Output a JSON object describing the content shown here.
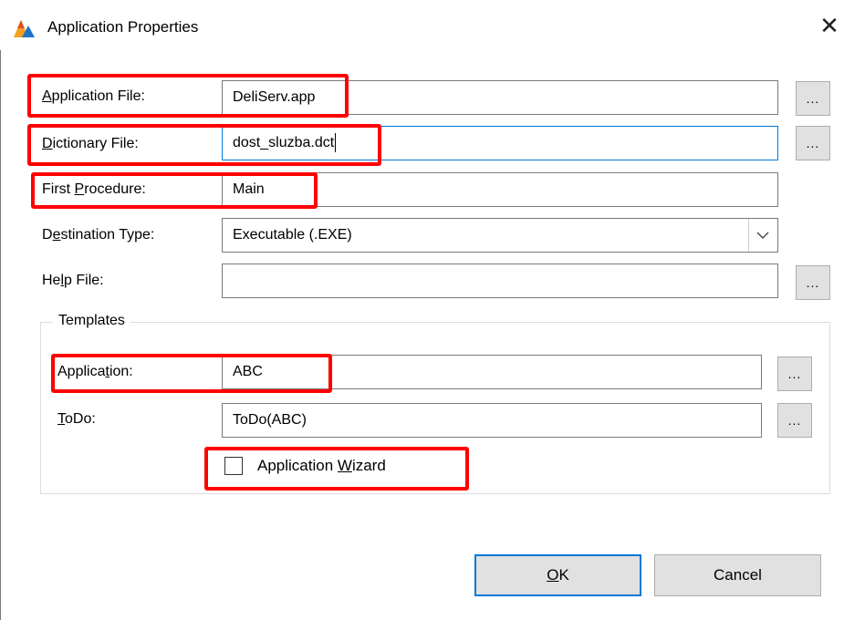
{
  "window": {
    "title": "Application Properties",
    "close_glyph": "✕",
    "app_icon": "clarion-app-icon"
  },
  "fields": {
    "application_file": {
      "label_pre": "",
      "label_key": "A",
      "label_post": "pplication File:",
      "value": "DeliServ.app"
    },
    "dictionary_file": {
      "label_pre": "",
      "label_key": "D",
      "label_post": "ictionary File:",
      "value": "dost_sluzba.dct"
    },
    "first_procedure": {
      "label_pre": "First ",
      "label_key": "P",
      "label_post": "rocedure:",
      "value": "Main"
    },
    "destination_type": {
      "label_pre": "D",
      "label_key": "e",
      "label_post": "stination Type:",
      "value": "Executable (.EXE)"
    },
    "help_file": {
      "label_pre": "He",
      "label_key": "l",
      "label_post": "p File:",
      "value": ""
    }
  },
  "browse_label": "...",
  "templates": {
    "group_title": "Templates",
    "application": {
      "label_pre": "Applica",
      "label_key": "t",
      "label_post": "ion:",
      "value": "ABC"
    },
    "todo": {
      "label_pre": "",
      "label_key": "T",
      "label_post": "oDo:",
      "value": "ToDo(ABC)"
    },
    "wizard": {
      "label_pre": "Application ",
      "label_key": "W",
      "label_post": "izard",
      "checked": false
    }
  },
  "buttons": {
    "ok": {
      "label_pre": "",
      "label_key": "O",
      "label_post": "K"
    },
    "cancel": {
      "label": "Cancel"
    }
  },
  "colors": {
    "highlight": "#ff0000",
    "focus_border": "#0078d7",
    "button_face": "#e1e1e1"
  }
}
